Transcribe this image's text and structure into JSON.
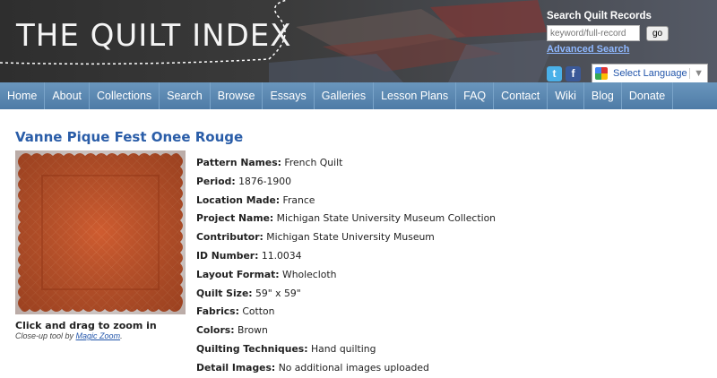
{
  "header": {
    "logo_text": "THE QUILT INDEX",
    "search_title": "Search Quilt Records",
    "search_placeholder": "keyword/full-record",
    "go_label": "go",
    "advanced_search": "Advanced Search",
    "social": {
      "twitter": "t",
      "facebook": "f"
    },
    "language_label": "Select Language",
    "language_arrow": "▼"
  },
  "nav": [
    "Home",
    "About",
    "Collections",
    "Search",
    "Browse",
    "Essays",
    "Galleries",
    "Lesson Plans",
    "FAQ",
    "Contact",
    "Wiki",
    "Blog",
    "Donate"
  ],
  "page": {
    "title": "Vanne Pique Fest Onee Rouge",
    "zoom_label": "Click and drag to zoom in",
    "zoom_sub_prefix": "Close-up tool by ",
    "zoom_sub_link": "Magic Zoom",
    "zoom_sub_suffix": "."
  },
  "details": [
    {
      "label": "Pattern Names:",
      "value": "French Quilt"
    },
    {
      "label": "Period:",
      "value": "1876-1900"
    },
    {
      "label": "Location Made:",
      "value": "France"
    },
    {
      "label": "Project Name:",
      "value": "Michigan State University Museum Collection"
    },
    {
      "label": "Contributor:",
      "value": "Michigan State University Museum"
    },
    {
      "label": "ID Number:",
      "value": "11.0034"
    },
    {
      "label": "Layout Format:",
      "value": "Wholecloth"
    },
    {
      "label": "Quilt Size:",
      "value": "59\" x 59\""
    },
    {
      "label": "Fabrics:",
      "value": "Cotton"
    },
    {
      "label": "Colors:",
      "value": "Brown"
    },
    {
      "label": "Quilting Techniques:",
      "value": "Hand quilting"
    },
    {
      "label": "Detail Images:",
      "value": "No additional images uploaded"
    }
  ],
  "colors": {
    "nav_bg": "#5a87b2",
    "title": "#2a5da8",
    "quilt": "#cc5a2e"
  }
}
